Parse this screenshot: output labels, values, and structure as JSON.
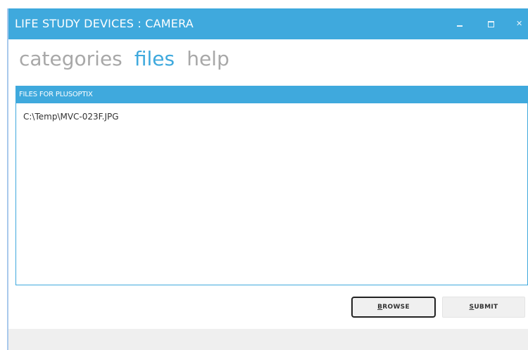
{
  "window": {
    "title": "LIFE STUDY DEVICES : CAMERA",
    "controls": {
      "minimize": "minimize-icon",
      "maximize": "maximize-icon",
      "close": "close-icon"
    }
  },
  "nav": {
    "items": [
      {
        "label": "categories",
        "active": false
      },
      {
        "label": "files",
        "active": true
      },
      {
        "label": "help",
        "active": false
      }
    ]
  },
  "panel": {
    "header": "FILES FOR PLUSOPTIX",
    "files": [
      "C:\\Temp\\MVC-023F.JPG"
    ]
  },
  "buttons": {
    "browse": {
      "accel": "B",
      "rest": "ROWSE"
    },
    "submit": {
      "accel": "S",
      "rest": "UBMIT"
    }
  },
  "colors": {
    "accent": "#3fa9dd",
    "inactive_nav": "#a8a8a8"
  }
}
